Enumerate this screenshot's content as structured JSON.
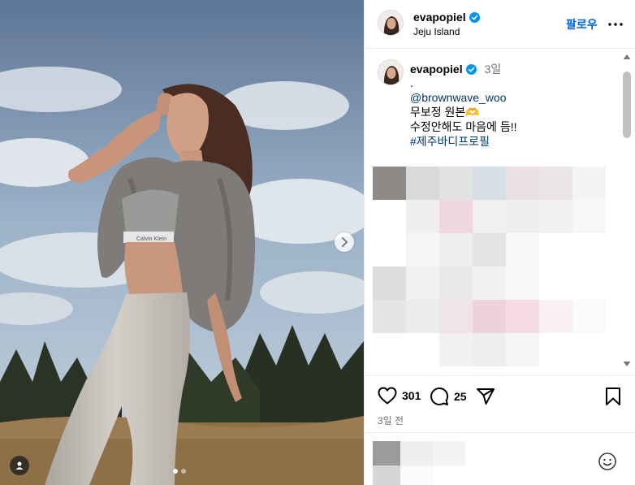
{
  "post": {
    "username": "evapopiel",
    "location": "Jeju Island",
    "follow_label": "팔로우",
    "more_icon": "more-horizontal-icon"
  },
  "caption": {
    "username": "evapopiel",
    "time": "3일",
    "lines": [
      ".",
      "@brownwave_woo",
      "무보정 원본🫶",
      "수정안해도 마음에 듬!!",
      "#제주바디프로필"
    ]
  },
  "actions": {
    "like_count": "301",
    "comment_count": "25",
    "date": "3일 전"
  },
  "carousel": {
    "current": 1,
    "total": 2
  },
  "colors": {
    "link": "#00376b",
    "follow": "#0064e0",
    "verified": "#0095f6",
    "muted": "#737373"
  }
}
